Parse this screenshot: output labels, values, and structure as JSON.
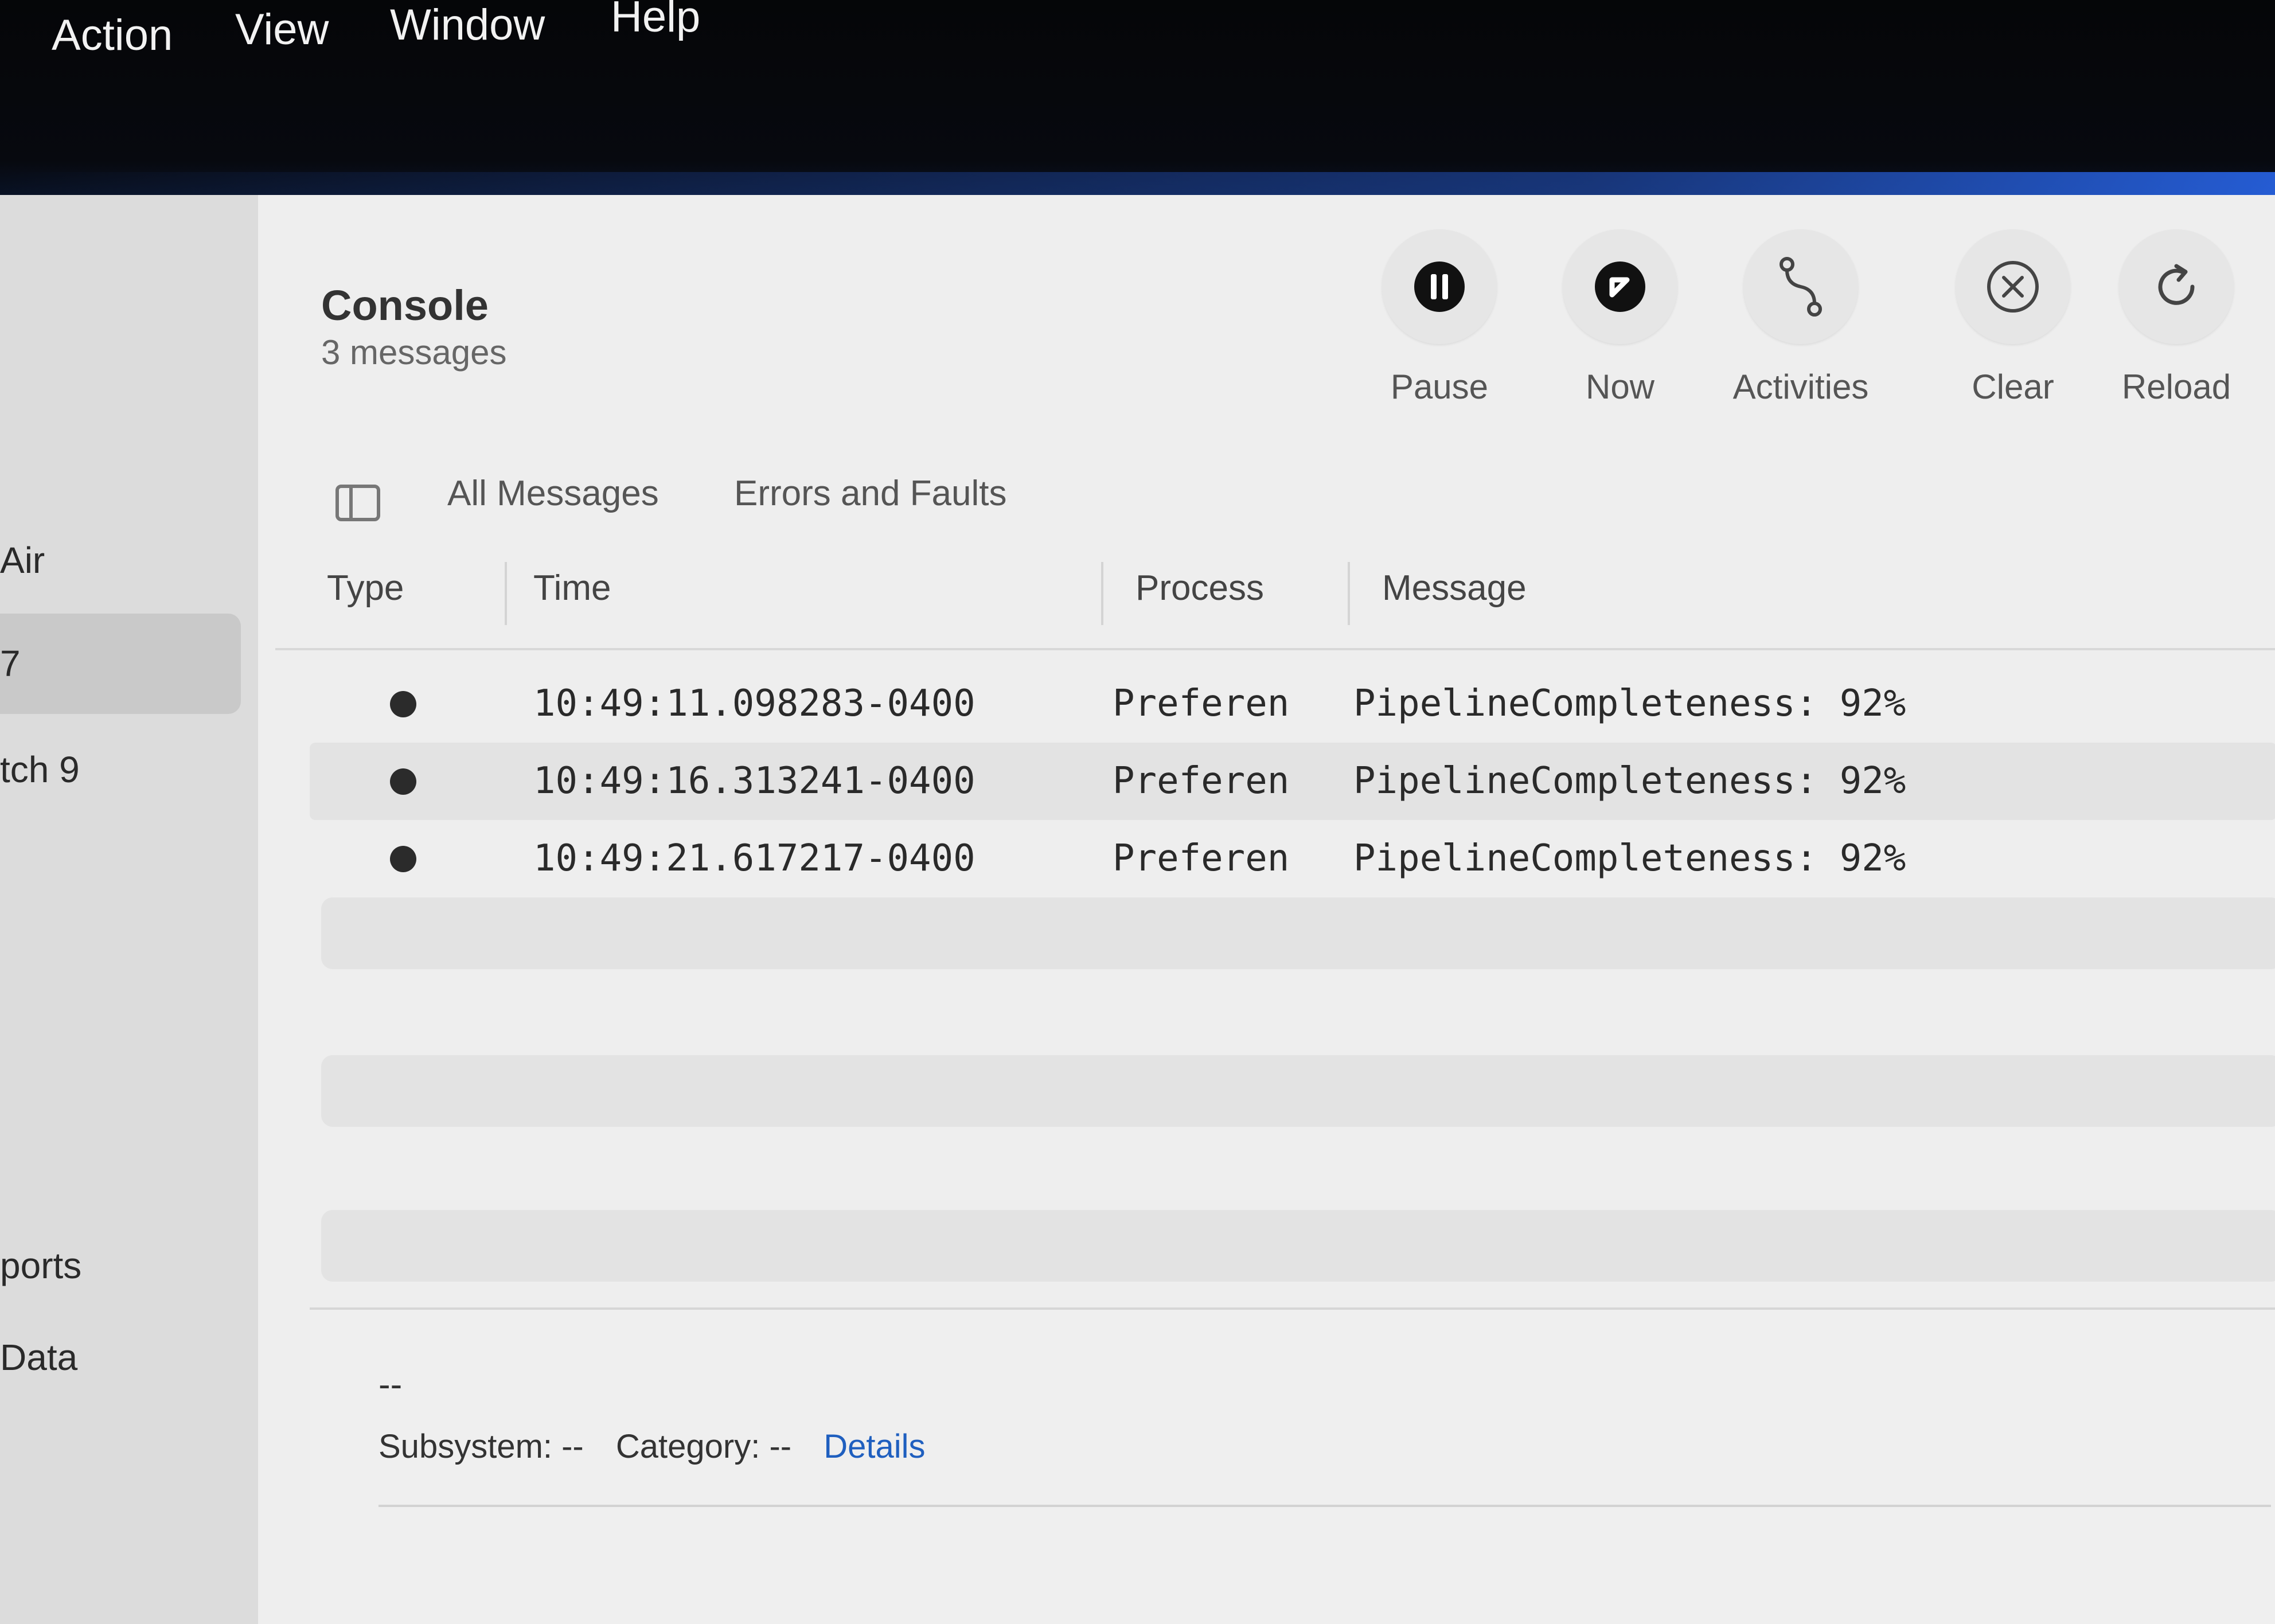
{
  "menubar": {
    "items": [
      "Action",
      "View",
      "Window",
      "Help"
    ]
  },
  "sidebar": {
    "items": [
      "Air",
      "7",
      "tch 9",
      "ports",
      "Data"
    ]
  },
  "header": {
    "title": "Console",
    "subtitle": "3 messages"
  },
  "toolbar": {
    "pause_label": "Pause",
    "now_label": "Now",
    "activities_label": "Activities",
    "clear_label": "Clear",
    "reload_label": "Reload"
  },
  "filters": {
    "all_messages": "All Messages",
    "errors_and_faults": "Errors and Faults"
  },
  "table": {
    "columns": [
      "Type",
      "Time",
      "Process",
      "Message"
    ],
    "rows": [
      {
        "time": "10:49:11.098283-0400",
        "process": "Preferen",
        "message": "PipelineCompleteness: 92%"
      },
      {
        "time": "10:49:16.313241-0400",
        "process": "Preferen",
        "message": "PipelineCompleteness: 92%"
      },
      {
        "time": "10:49:21.617217-0400",
        "process": "Preferen",
        "message": "PipelineCompleteness: 92%"
      }
    ]
  },
  "details": {
    "placeholder": "--",
    "subsystem": "Subsystem: --",
    "category": "Category: --",
    "details_link": "Details"
  },
  "colors": {
    "link": "#1f5fbf",
    "row_dot": "#2b2b2b"
  }
}
